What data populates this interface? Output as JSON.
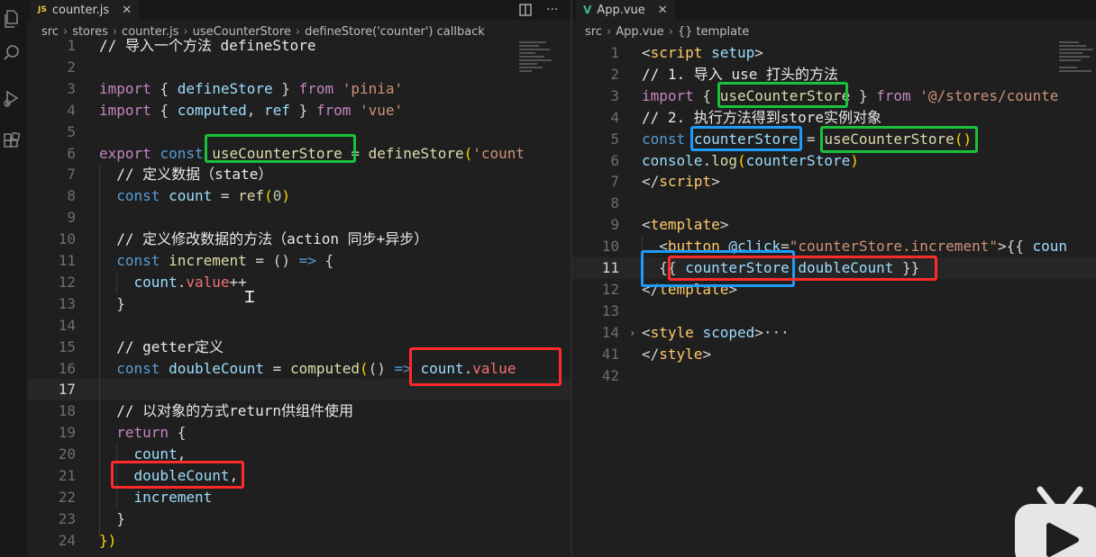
{
  "colors": {
    "editor_bg": "#1f1f1f",
    "tabbar_bg": "#181818",
    "highlight_green": "#19c23a",
    "highlight_red": "#ff2a2a",
    "highlight_blue": "#1e9bff"
  },
  "activity_bar": {
    "icons": [
      "files-icon",
      "search-icon",
      "run-debug-icon",
      "extensions-icon"
    ]
  },
  "left_editor": {
    "tab": {
      "icon": "JS",
      "label": "counter.js"
    },
    "breadcrumb": [
      "src",
      "stores",
      "counter.js",
      "useCounterStore",
      "defineStore('counter') callback"
    ],
    "lines": [
      {
        "num": "1",
        "tokens": [
          [
            "cm",
            "// 导入一个方法 defineStore"
          ]
        ]
      },
      {
        "num": "2",
        "tokens": []
      },
      {
        "num": "3",
        "tokens": [
          [
            "kw",
            "import"
          ],
          [
            "punc",
            " { "
          ],
          [
            "id",
            "defineStore"
          ],
          [
            "punc",
            " } "
          ],
          [
            "kw",
            "from"
          ],
          [
            "punc",
            " "
          ],
          [
            "str",
            "'pinia'"
          ]
        ]
      },
      {
        "num": "4",
        "tokens": [
          [
            "kw",
            "import"
          ],
          [
            "punc",
            " { "
          ],
          [
            "id",
            "computed"
          ],
          [
            "punc",
            ", "
          ],
          [
            "id",
            "ref"
          ],
          [
            "punc",
            " } "
          ],
          [
            "kw",
            "from"
          ],
          [
            "punc",
            " "
          ],
          [
            "str",
            "'vue'"
          ]
        ]
      },
      {
        "num": "5",
        "tokens": []
      },
      {
        "num": "6",
        "tokens": [
          [
            "kw",
            "export"
          ],
          [
            "punc",
            " "
          ],
          [
            "kw2",
            "const"
          ],
          [
            "punc",
            " "
          ],
          [
            "fn",
            "useCounterStore"
          ],
          [
            "punc",
            " = "
          ],
          [
            "fn",
            "defineStore"
          ],
          [
            "brk",
            "("
          ],
          [
            "str",
            "'count"
          ]
        ]
      },
      {
        "num": "7",
        "tokens": [
          [
            "punc",
            "  "
          ],
          [
            "cm",
            "// 定义数据（state）"
          ]
        ]
      },
      {
        "num": "8",
        "tokens": [
          [
            "punc",
            "  "
          ],
          [
            "kw2",
            "const"
          ],
          [
            "punc",
            " "
          ],
          [
            "id",
            "count"
          ],
          [
            "punc",
            " = "
          ],
          [
            "fn",
            "ref"
          ],
          [
            "brk",
            "("
          ],
          [
            "num",
            "0"
          ],
          [
            "brk",
            ")"
          ]
        ]
      },
      {
        "num": "9",
        "tokens": []
      },
      {
        "num": "10",
        "tokens": [
          [
            "punc",
            "  "
          ],
          [
            "cm",
            "// 定义修改数据的方法（action 同步+异步）"
          ]
        ]
      },
      {
        "num": "11",
        "tokens": [
          [
            "punc",
            "  "
          ],
          [
            "kw2",
            "const"
          ],
          [
            "punc",
            " "
          ],
          [
            "fn",
            "increment"
          ],
          [
            "punc",
            " = () "
          ],
          [
            "kw2",
            "=>"
          ],
          [
            "punc",
            " {"
          ]
        ]
      },
      {
        "num": "12",
        "tokens": [
          [
            "punc",
            "    "
          ],
          [
            "id",
            "count"
          ],
          [
            "punc",
            "."
          ],
          [
            "prop",
            "value"
          ],
          [
            "punc",
            "++"
          ]
        ]
      },
      {
        "num": "13",
        "tokens": [
          [
            "punc",
            "  }"
          ]
        ]
      },
      {
        "num": "14",
        "tokens": []
      },
      {
        "num": "15",
        "tokens": [
          [
            "punc",
            "  "
          ],
          [
            "cm",
            "// getter定义"
          ]
        ]
      },
      {
        "num": "16",
        "tokens": [
          [
            "punc",
            "  "
          ],
          [
            "kw2",
            "const"
          ],
          [
            "punc",
            " "
          ],
          [
            "id",
            "doubleCount"
          ],
          [
            "punc",
            " = "
          ],
          [
            "fn",
            "computed"
          ],
          [
            "brk",
            "("
          ],
          [
            "punc",
            "() "
          ],
          [
            "kw2",
            "=>"
          ],
          [
            "punc",
            " "
          ],
          [
            "id",
            "count"
          ],
          [
            "punc",
            "."
          ],
          [
            "prop",
            "value"
          ]
        ]
      },
      {
        "num": "17",
        "tokens": [],
        "current": true
      },
      {
        "num": "18",
        "tokens": [
          [
            "punc",
            "  "
          ],
          [
            "cm",
            "// 以对象的方式return供组件使用"
          ]
        ]
      },
      {
        "num": "19",
        "tokens": [
          [
            "punc",
            "  "
          ],
          [
            "kw",
            "return"
          ],
          [
            "punc",
            " {"
          ]
        ]
      },
      {
        "num": "20",
        "tokens": [
          [
            "punc",
            "    "
          ],
          [
            "id",
            "count"
          ],
          [
            "punc",
            ","
          ]
        ]
      },
      {
        "num": "21",
        "tokens": [
          [
            "punc",
            "    "
          ],
          [
            "id",
            "doubleCount"
          ],
          [
            "punc",
            ","
          ]
        ]
      },
      {
        "num": "22",
        "tokens": [
          [
            "punc",
            "    "
          ],
          [
            "id",
            "increment"
          ]
        ]
      },
      {
        "num": "23",
        "tokens": [
          [
            "punc",
            "  }"
          ]
        ]
      },
      {
        "num": "24",
        "tokens": [
          [
            "brk",
            "})"
          ]
        ]
      }
    ]
  },
  "right_editor": {
    "tab": {
      "icon": "V",
      "label": "App.vue"
    },
    "breadcrumb": [
      "src",
      "App.vue",
      "{} template"
    ],
    "lines": [
      {
        "num": "1",
        "tokens": [
          [
            "punc",
            "<"
          ],
          [
            "tag",
            "script"
          ],
          [
            "punc",
            " "
          ],
          [
            "attr",
            "setup"
          ],
          [
            "punc",
            ">"
          ]
        ]
      },
      {
        "num": "2",
        "tokens": [
          [
            "cm",
            "// 1. 导入 use 打头的方法"
          ]
        ]
      },
      {
        "num": "3",
        "tokens": [
          [
            "kw",
            "import"
          ],
          [
            "punc",
            " { "
          ],
          [
            "fn",
            "useCounterStore"
          ],
          [
            "punc",
            " } "
          ],
          [
            "kw",
            "from"
          ],
          [
            "punc",
            " "
          ],
          [
            "str",
            "'@/stores/counte"
          ]
        ]
      },
      {
        "num": "4",
        "tokens": [
          [
            "cm",
            "// 2. 执行方法得到store实例对象"
          ]
        ]
      },
      {
        "num": "5",
        "tokens": [
          [
            "kw2",
            "const"
          ],
          [
            "punc",
            " "
          ],
          [
            "id",
            "counterStore"
          ],
          [
            "punc",
            " = "
          ],
          [
            "fn",
            "useCounterStore"
          ],
          [
            "brk",
            "()"
          ]
        ]
      },
      {
        "num": "6",
        "tokens": [
          [
            "id",
            "console"
          ],
          [
            "punc",
            "."
          ],
          [
            "fn",
            "log"
          ],
          [
            "brk",
            "("
          ],
          [
            "id",
            "counterStore"
          ],
          [
            "brk",
            ")"
          ]
        ]
      },
      {
        "num": "7",
        "tokens": [
          [
            "punc",
            "</"
          ],
          [
            "tag",
            "script"
          ],
          [
            "punc",
            ">"
          ]
        ]
      },
      {
        "num": "8",
        "tokens": []
      },
      {
        "num": "9",
        "tokens": [
          [
            "punc",
            "<"
          ],
          [
            "tag",
            "template"
          ],
          [
            "punc",
            ">"
          ]
        ]
      },
      {
        "num": "10",
        "tokens": [
          [
            "punc",
            "  <"
          ],
          [
            "tag",
            "button"
          ],
          [
            "punc",
            " "
          ],
          [
            "attr",
            "@click"
          ],
          [
            "punc",
            "="
          ],
          [
            "str",
            "\"counterStore.increment\""
          ],
          [
            "punc",
            ">{{ "
          ],
          [
            "id",
            "coun"
          ]
        ]
      },
      {
        "num": "11",
        "tokens": [
          [
            "punc",
            "  {{ "
          ],
          [
            "id",
            "counterStore"
          ],
          [
            "punc",
            "."
          ],
          [
            "id",
            "doubleCount"
          ],
          [
            "punc",
            " }}"
          ]
        ],
        "current": true
      },
      {
        "num": "12",
        "tokens": [
          [
            "punc",
            "</"
          ],
          [
            "tag",
            "template"
          ],
          [
            "punc",
            ">"
          ]
        ]
      },
      {
        "num": "13",
        "tokens": []
      },
      {
        "num": "14",
        "tokens": [
          [
            "punc",
            "<"
          ],
          [
            "tag",
            "style"
          ],
          [
            "punc",
            " "
          ],
          [
            "attr",
            "scoped"
          ],
          [
            "punc",
            ">···"
          ]
        ],
        "fold": true
      },
      {
        "num": "41",
        "tokens": [
          [
            "punc",
            "</"
          ],
          [
            "tag",
            "style"
          ],
          [
            "punc",
            ">"
          ]
        ]
      },
      {
        "num": "42",
        "tokens": []
      }
    ]
  }
}
